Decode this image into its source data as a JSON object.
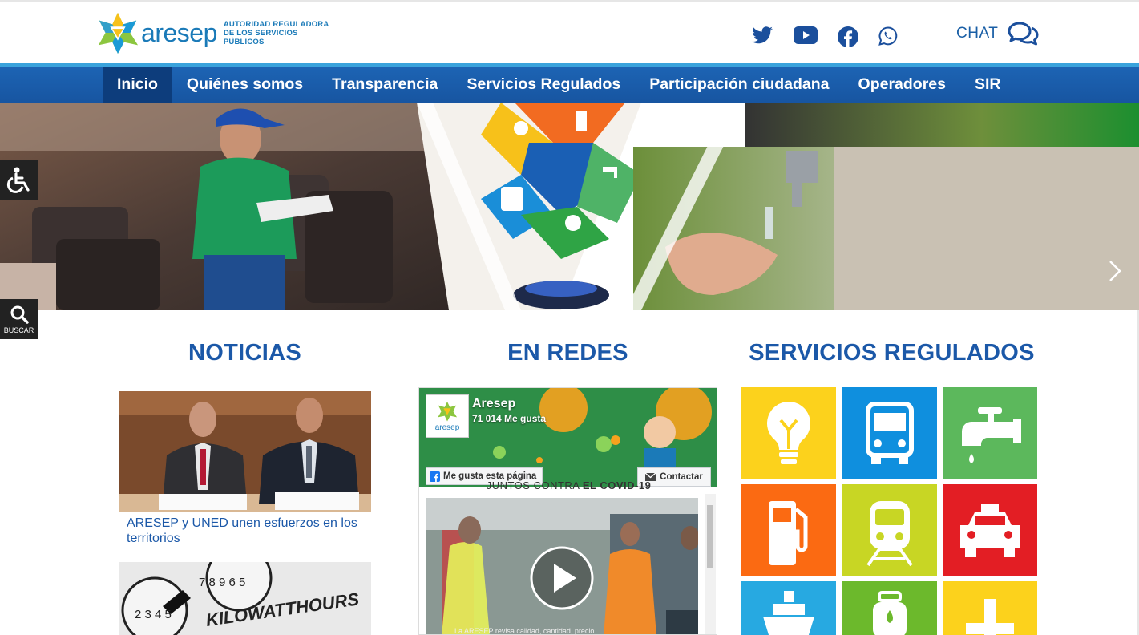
{
  "brand": {
    "name": "aresep",
    "tagline_1": "AUTORIDAD REGULADORA",
    "tagline_2": "DE LOS SERVICIOS PÚBLICOS"
  },
  "social": [
    {
      "name": "twitter-icon"
    },
    {
      "name": "youtube-icon"
    },
    {
      "name": "facebook-icon"
    },
    {
      "name": "whatsapp-icon"
    }
  ],
  "chat": {
    "label": "CHAT"
  },
  "nav": {
    "items": [
      "Inicio",
      "Quiénes somos",
      "Transparencia",
      "Servicios Regulados",
      "Participación ciudadana",
      "Operadores",
      "SIR"
    ],
    "active": "Inicio"
  },
  "side_tools": {
    "search_label": "BUSCAR"
  },
  "sections": {
    "news_title": "NOTICIAS",
    "social_title": "EN REDES",
    "services_title": "SERVICIOS REGULADOS"
  },
  "news": [
    {
      "title": "ARESEP y UNED unen esfuerzos en los territorios"
    }
  ],
  "news_image_text": "KILOWATTHOURS",
  "facebook": {
    "page_name": "Aresep",
    "likes": "71 014 Me gusta",
    "like_button": "Me gusta esta página",
    "contact_button": "Contactar",
    "banner_text_a": "JUNTOS CONTRA ",
    "banner_text_b": "EL COVID-19",
    "avatar_text": "aresep",
    "video_caption": "La ARESEP revisa calidad, cantidad, precio"
  },
  "colors": {
    "brand_blue": "#1b58a8",
    "nav_blue": "#1d64b4",
    "nav_active": "#0d3d7c",
    "accent_cyan": "#3aa3dc"
  },
  "services": [
    {
      "name": "electricidad",
      "icon": "lightbulb-icon",
      "color": "#fcd21c"
    },
    {
      "name": "autobus",
      "icon": "bus-icon",
      "color": "#0f8fde"
    },
    {
      "name": "agua",
      "icon": "water-tap-icon",
      "color": "#5cb85c"
    },
    {
      "name": "combustibles",
      "icon": "fuel-pump-icon",
      "color": "#fb6a12"
    },
    {
      "name": "tren",
      "icon": "train-icon",
      "color": "#c8d624"
    },
    {
      "name": "taxi",
      "icon": "taxi-icon",
      "color": "#e31e24"
    },
    {
      "name": "cabotaje",
      "icon": "ship-icon",
      "color": "#27a9e1"
    },
    {
      "name": "gas",
      "icon": "gas-cylinder-icon",
      "color": "#6cb92c"
    },
    {
      "name": "mas",
      "icon": "plus-icon",
      "color": "#fcd21c"
    }
  ]
}
